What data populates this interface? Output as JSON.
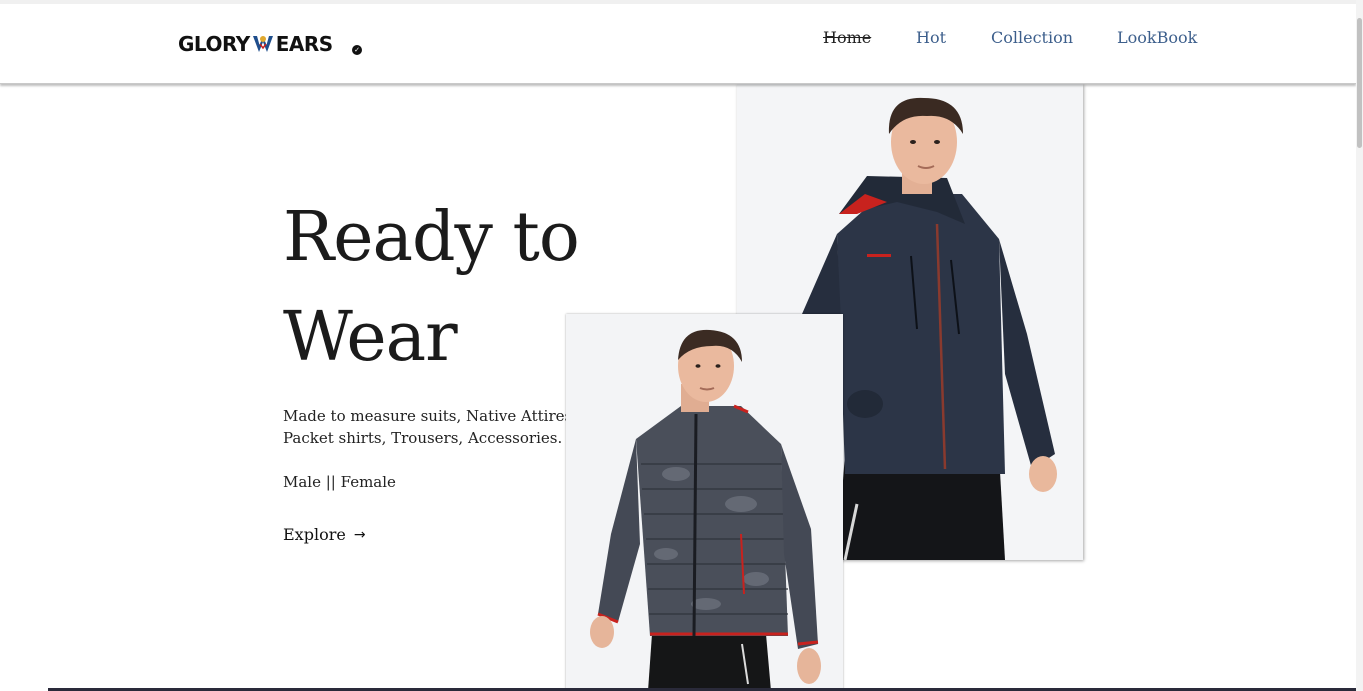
{
  "brand": {
    "logo_left": "GLORY",
    "logo_right": "EARS",
    "verified_glyph": "✓"
  },
  "nav": {
    "items": [
      {
        "label": "Home",
        "active": true
      },
      {
        "label": "Hot",
        "active": false
      },
      {
        "label": "Collection",
        "active": false
      },
      {
        "label": "LookBook",
        "active": false
      }
    ]
  },
  "hero": {
    "title_line1": "Ready to",
    "title_line2": "Wear",
    "description": "Made to measure suits, Native Attires, Packet shirts, Trousers, Accessories.",
    "gender": "Male || Female",
    "cta_label": "Explore",
    "cta_icon": "arrow-right-icon",
    "cta_glyph": "→"
  },
  "images": {
    "back": "man-navy-hooded-jacket-photo",
    "front": "man-camo-puffer-jacket-photo"
  },
  "colors": {
    "nav_link": "#3d5f8c",
    "text": "#1b1b1b",
    "jacket_navy": "#2c3547",
    "jacket_accent_red": "#c8221e",
    "puffer_grey": "#4a4f5a"
  }
}
